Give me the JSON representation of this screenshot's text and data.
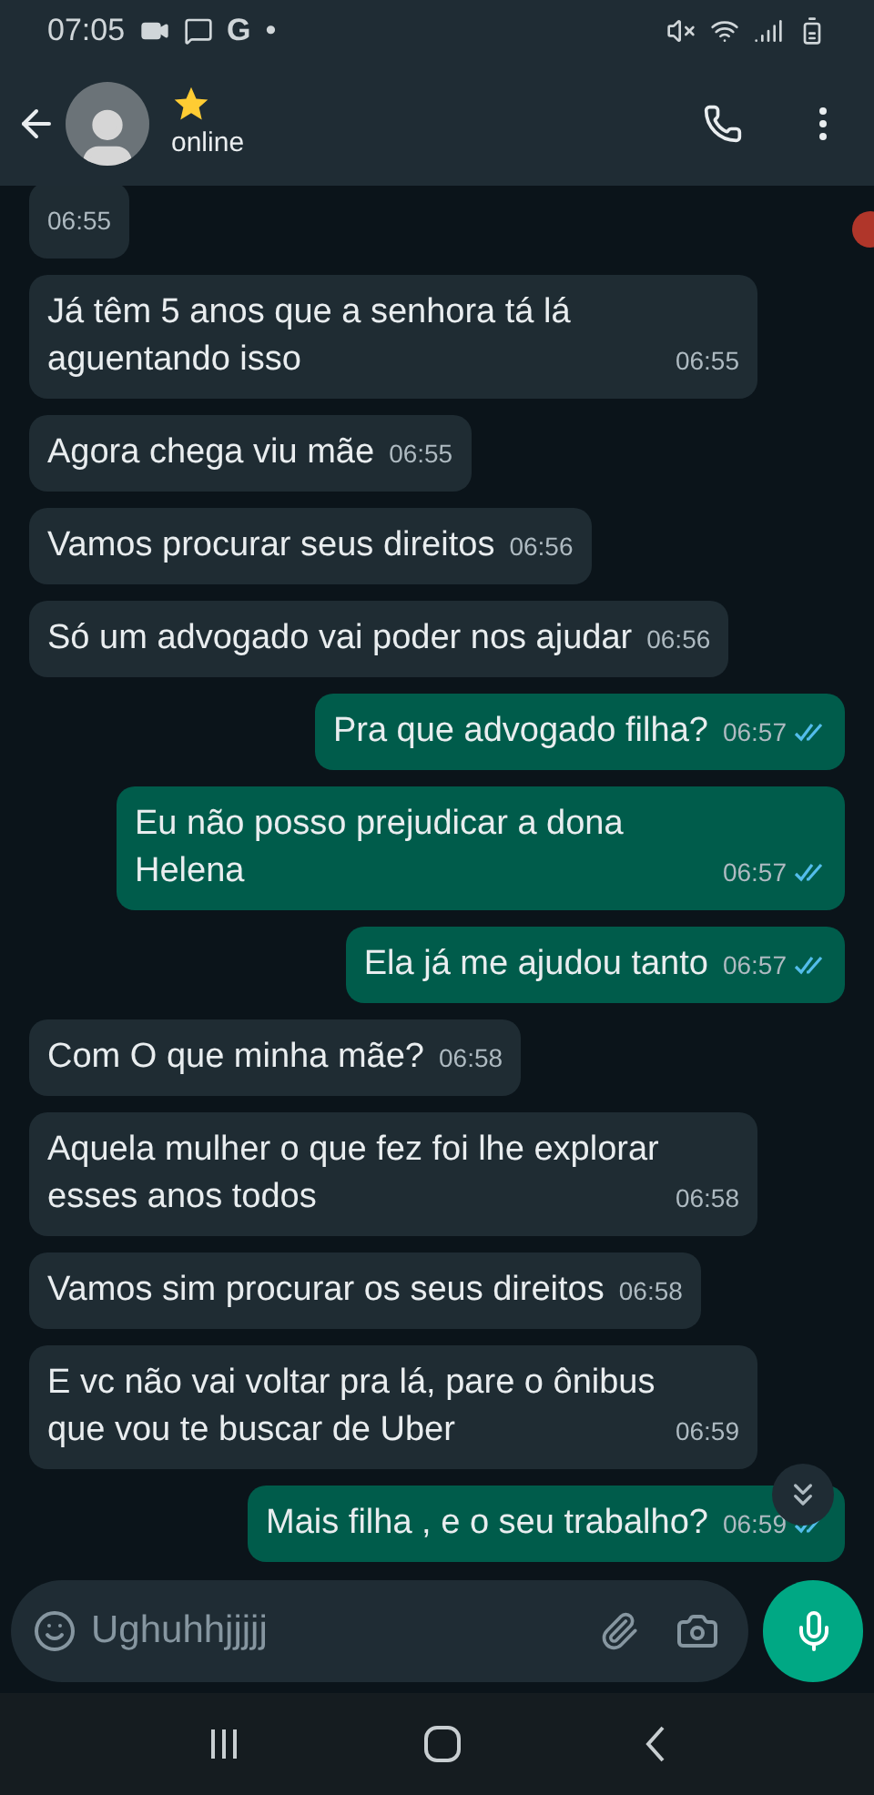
{
  "status_bar": {
    "time": "07:05",
    "g_label": "G",
    "dot": "•"
  },
  "header": {
    "status": "online"
  },
  "messages": [
    {
      "kind": "incoming",
      "time": "06:55"
    },
    {
      "kind": "incoming",
      "text": "Já têm 5 anos que a senhora tá lá aguentando isso",
      "time": "06:55"
    },
    {
      "kind": "incoming",
      "text": "Agora chega viu mãe",
      "time": "06:55"
    },
    {
      "kind": "incoming",
      "text": "Vamos procurar seus direitos",
      "time": "06:56"
    },
    {
      "kind": "incoming",
      "text": "Só um advogado vai poder nos ajudar",
      "time": "06:56"
    },
    {
      "kind": "outgoing",
      "text": "Pra que advogado filha?",
      "time": "06:57",
      "read": true
    },
    {
      "kind": "outgoing",
      "text": "Eu não posso prejudicar a dona Helena",
      "time": "06:57",
      "read": true
    },
    {
      "kind": "outgoing",
      "text": "Ela já me ajudou tanto",
      "time": "06:57",
      "read": true
    },
    {
      "kind": "incoming",
      "text": "Com O que minha mãe?",
      "time": "06:58"
    },
    {
      "kind": "incoming",
      "text": "Aquela mulher o que fez foi lhe explorar esses anos todos",
      "time": "06:58"
    },
    {
      "kind": "incoming",
      "text": "Vamos sim procurar os seus direitos",
      "time": "06:58"
    },
    {
      "kind": "incoming",
      "text": "E vc não vai voltar pra lá,  pare o ônibus que vou te buscar de Uber",
      "time": "06:59"
    },
    {
      "kind": "outgoing",
      "text": "Mais filha , e o seu trabalho?",
      "time": "06:59",
      "read": true
    }
  ],
  "composer": {
    "value": "Ughuhhjjjjj"
  }
}
